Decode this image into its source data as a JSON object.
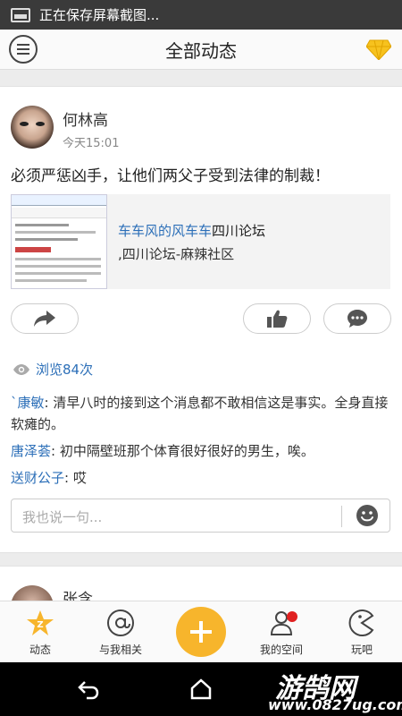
{
  "status_bar": {
    "notification": "正在保存屏幕截图..."
  },
  "header": {
    "title": "全部动态"
  },
  "post": {
    "author": "何林高",
    "time": "今天15:01",
    "text": "必须严惩凶手，让他们两父子受到法律的制裁！",
    "link": {
      "title_blue": "车车风的风车车",
      "title_dark": "四川论坛",
      "subtitle": ",四川论坛-麻辣社区"
    },
    "views": "浏览84次",
    "comments": [
      {
        "user": "`康敏",
        "text": ": 清早八时的接到这个消息都不敢相信这是事实。全身直接软瘫的。"
      },
      {
        "user": "唐泽荟",
        "text": ": 初中隔壁班那个体育很好很好的男生，唉。"
      },
      {
        "user": "送财公子",
        "text": ": 哎"
      }
    ],
    "reply_placeholder": "我也说一句..."
  },
  "next_post": {
    "author": "张含"
  },
  "tabs": [
    {
      "label": "动态"
    },
    {
      "label": "与我相关"
    },
    {
      "label": ""
    },
    {
      "label": "我的空间"
    },
    {
      "label": "玩吧"
    }
  ],
  "watermark": {
    "big": "游鹄网",
    "small": "www.0827ug.com"
  },
  "colors": {
    "accent": "#f7b52c",
    "link": "#2c6fb8",
    "badge": "#e02020"
  }
}
